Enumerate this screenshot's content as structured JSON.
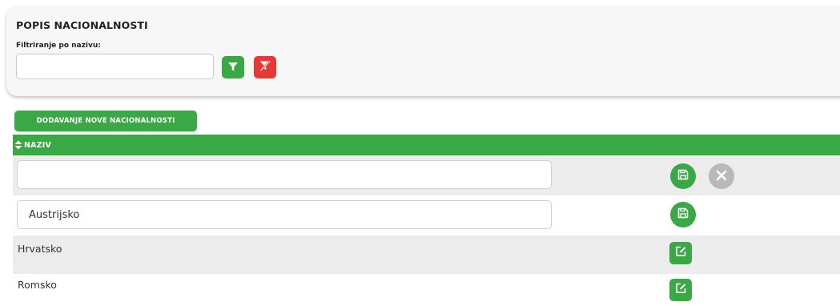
{
  "filter_panel": {
    "title": "POPIS NACIONALNOSTI",
    "filter_label": "Filtriranje po nazivu:",
    "filter_value": "",
    "filter_icon": "filter-icon",
    "clear_filter_icon": "filter-clear-icon"
  },
  "add_button": {
    "label": "DODAVANJE NOVE NACIONALNOSTI"
  },
  "table": {
    "column_header": "NAZIV",
    "sort_icon": "sort-icon",
    "rows": [
      {
        "mode": "new",
        "value": "",
        "actions": [
          "save-icon",
          "cancel-icon"
        ]
      },
      {
        "mode": "editing",
        "value": "Austrijsko",
        "actions": [
          "save-icon"
        ]
      },
      {
        "mode": "view",
        "value": "Hrvatsko",
        "actions": [
          "edit-icon"
        ]
      },
      {
        "mode": "view",
        "value": "Romsko",
        "actions": [
          "edit-icon"
        ]
      }
    ]
  },
  "colors": {
    "primary_green": "#3aa845",
    "danger_red": "#e53935",
    "cancel_gray": "#b9b9b9",
    "row_stripe": "#ececec"
  }
}
